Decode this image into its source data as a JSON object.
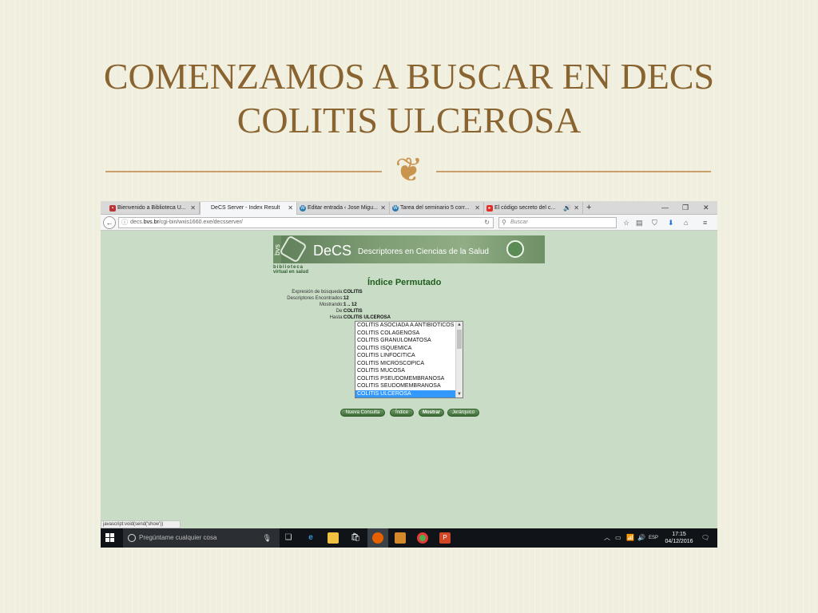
{
  "slide": {
    "title_line1": "COMENZAMOS A BUSCAR EN DECS",
    "title_line2": "COLITIS ULCEROSA",
    "ornament": "❦",
    "colors": {
      "title": "#8a6430",
      "rule": "#c9a06a",
      "background": "#efeedd"
    }
  },
  "browser": {
    "tabs": [
      {
        "label": "Bienvenido a Biblioteca U...",
        "icon": "library-favicon",
        "active": false
      },
      {
        "label": "DeCS Server - Index Result",
        "icon": "",
        "active": true
      },
      {
        "label": "Editar entrada ‹ Jose Migu...",
        "icon": "wordpress-favicon",
        "active": false
      },
      {
        "label": "Tarea del seminario 5 corr...",
        "icon": "wordpress-favicon",
        "active": false
      },
      {
        "label": "El código secreto del c...",
        "icon": "youtube-favicon",
        "active": false
      }
    ],
    "close_glyph": "✕",
    "new_tab": "+",
    "window_controls": [
      "—",
      "❐",
      "✕"
    ],
    "url_host": "decs.",
    "url_domain": "bvs.br",
    "url_path": "/cgi-bin/wxis1660.exe/decsserver/",
    "search_placeholder": "Buscar",
    "status_text": "javascript:void(send('show'))"
  },
  "decs": {
    "logo_side": "bvs",
    "logo_word": "DeCS",
    "logo_desc": "Descriptores en Ciencias de la Salud",
    "biblio_line1": "biblioteca",
    "biblio_line2": "virtual en salud",
    "heading": "Índice Permutado",
    "fields": [
      {
        "label": "Expresión de búsqueda:",
        "value": "COLITIS"
      },
      {
        "label": "Descriptores Encontrados:",
        "value": "12"
      },
      {
        "label": "Mostrando:",
        "value": "1 .. 12"
      },
      {
        "label": "De:",
        "value": "COLITIS"
      },
      {
        "label": "Hasta:",
        "value": "COLITIS ULCEROSA"
      }
    ],
    "results": [
      "COLITIS ASOCIADA A ANTIBIOTICOS",
      "COLITIS COLAGENOSA",
      "COLITIS GRANULOMATOSA",
      "COLITIS ISQUEMICA",
      "COLITIS LINFOCITICA",
      "COLITIS MICROSCOPICA",
      "COLITIS MUCOSA",
      "COLITIS PSEUDOMEMBRANOSA",
      "COLITIS SEUDOMEMBRANOSA",
      "COLITIS ULCEROSA"
    ],
    "selected_result": "COLITIS ULCEROSA",
    "buttons": {
      "nueva": "Nueva Consulta",
      "indice": "Índice",
      "mostrar": "Mostrar",
      "jerarquico": "Jerárquico"
    }
  },
  "taskbar": {
    "search_placeholder": "Pregúntame cualquier cosa",
    "language": "ESP",
    "time": "17:15",
    "date": "04/12/2016"
  }
}
